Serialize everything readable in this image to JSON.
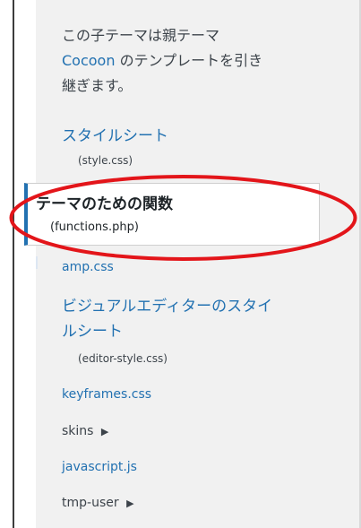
{
  "intro": {
    "line1": "この子テーマは親テーマ",
    "parent_theme_link": "Cocoon",
    "line2_rest": " のテンプレートを引き",
    "line3": "継ぎます。"
  },
  "files": [
    {
      "name": "スタイルシート",
      "sub": "(style.css)"
    },
    {
      "name": "テーマのための関数",
      "sub": "(functions.php)"
    },
    {
      "name": "amp.css"
    },
    {
      "name": "ビジュアルエディターのスタイ",
      "name_line2": "ルシート",
      "sub": "(editor-style.css)"
    },
    {
      "name": "keyframes.css"
    },
    {
      "name": "skins",
      "arrow": "▶"
    },
    {
      "name": "javascript.js"
    },
    {
      "name": "tmp-user",
      "arrow": "▶"
    }
  ],
  "colors": {
    "link": "#2271b1",
    "highlight": "#e3151a",
    "panel_bg": "#f1f1f1"
  }
}
